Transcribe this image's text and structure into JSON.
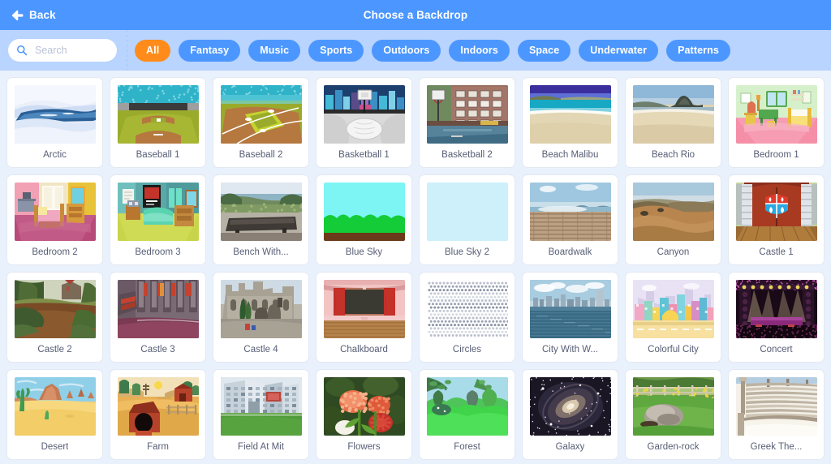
{
  "header": {
    "back_label": "Back",
    "back_icon": "arrow-left-icon",
    "title": "Choose a Backdrop",
    "bg_color": "#4c97ff"
  },
  "filter_bar": {
    "bg_color": "#b8d4ff",
    "search": {
      "icon": "search-icon",
      "placeholder": "Search",
      "value": ""
    },
    "tags": [
      {
        "label": "All",
        "active": true
      },
      {
        "label": "Fantasy",
        "active": false
      },
      {
        "label": "Music",
        "active": false
      },
      {
        "label": "Sports",
        "active": false
      },
      {
        "label": "Outdoors",
        "active": false
      },
      {
        "label": "Indoors",
        "active": false
      },
      {
        "label": "Space",
        "active": false
      },
      {
        "label": "Underwater",
        "active": false
      },
      {
        "label": "Patterns",
        "active": false
      }
    ],
    "active_color": "#ff8c1a",
    "tag_color": "#4c97ff"
  },
  "grid": {
    "columns": 8,
    "items": [
      {
        "label": "Arctic",
        "art": "arctic"
      },
      {
        "label": "Baseball 1",
        "art": "baseball1"
      },
      {
        "label": "Baseball 2",
        "art": "baseball2"
      },
      {
        "label": "Basketball 1",
        "art": "basketball1"
      },
      {
        "label": "Basketball 2",
        "art": "basketball2"
      },
      {
        "label": "Beach Malibu",
        "art": "beachmalibu"
      },
      {
        "label": "Beach Rio",
        "art": "beachrio"
      },
      {
        "label": "Bedroom 1",
        "art": "bedroom1"
      },
      {
        "label": "Bedroom 2",
        "art": "bedroom2"
      },
      {
        "label": "Bedroom 3",
        "art": "bedroom3"
      },
      {
        "label": "Bench With...",
        "art": "bench"
      },
      {
        "label": "Blue Sky",
        "art": "bluesky"
      },
      {
        "label": "Blue Sky 2",
        "art": "bluesky2"
      },
      {
        "label": "Boardwalk",
        "art": "boardwalk"
      },
      {
        "label": "Canyon",
        "art": "canyon"
      },
      {
        "label": "Castle 1",
        "art": "castle1"
      },
      {
        "label": "Castle 2",
        "art": "castle2"
      },
      {
        "label": "Castle 3",
        "art": "castle3"
      },
      {
        "label": "Castle 4",
        "art": "castle4"
      },
      {
        "label": "Chalkboard",
        "art": "chalkboard"
      },
      {
        "label": "Circles",
        "art": "circles"
      },
      {
        "label": "City With W...",
        "art": "citywater"
      },
      {
        "label": "Colorful City",
        "art": "colorfulcity"
      },
      {
        "label": "Concert",
        "art": "concert"
      },
      {
        "label": "Desert",
        "art": "desert"
      },
      {
        "label": "Farm",
        "art": "farm"
      },
      {
        "label": "Field At Mit",
        "art": "fieldmit"
      },
      {
        "label": "Flowers",
        "art": "flowers"
      },
      {
        "label": "Forest",
        "art": "forest"
      },
      {
        "label": "Galaxy",
        "art": "galaxy"
      },
      {
        "label": "Garden-rock",
        "art": "gardenrock"
      },
      {
        "label": "Greek The...",
        "art": "greektheater"
      }
    ]
  }
}
